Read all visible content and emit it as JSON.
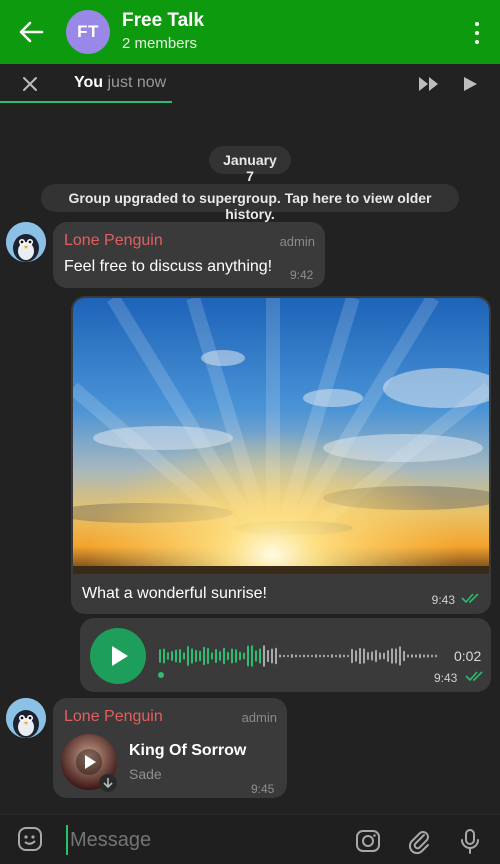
{
  "header": {
    "avatar_initials": "FT",
    "title": "Free Talk",
    "subtitle": "2 members",
    "back_icon": "arrow-left-icon",
    "menu_icon": "more-vert-icon",
    "avatar_color": "#9a88e8",
    "bar_color": "#0e9a0e"
  },
  "story_bar": {
    "author": "You",
    "time": "just now",
    "close_icon": "close-icon",
    "fast_forward_icon": "fast-forward-icon",
    "play_icon": "play-icon"
  },
  "chat": {
    "date_label": "January 7",
    "system_message": "Group upgraded to supergroup. Tap here to view older history.",
    "messages": [
      {
        "sender": "Lone Penguin",
        "role": "admin",
        "text": "Feel free to discuss anything!",
        "time": "9:42"
      }
    ],
    "photo_message": {
      "caption": "What a wonderful sunrise!",
      "time": "9:43"
    },
    "voice_message": {
      "duration": "0:02",
      "time": "9:43",
      "progress": 0
    },
    "music_message": {
      "sender": "Lone Penguin",
      "role": "admin",
      "track": "King Of Sorrow",
      "artist": "Sade",
      "time": "9:45"
    }
  },
  "input_bar": {
    "placeholder": "Message",
    "emoji_icon": "sticker-emoji-icon",
    "camera_icon": "camera-icon",
    "attach_icon": "paperclip-icon",
    "mic_icon": "microphone-icon"
  },
  "colors": {
    "accent_green": "#2dbd6e",
    "sender_red": "#e06060",
    "bubble": "#3a3a3a",
    "background": "#222222"
  }
}
